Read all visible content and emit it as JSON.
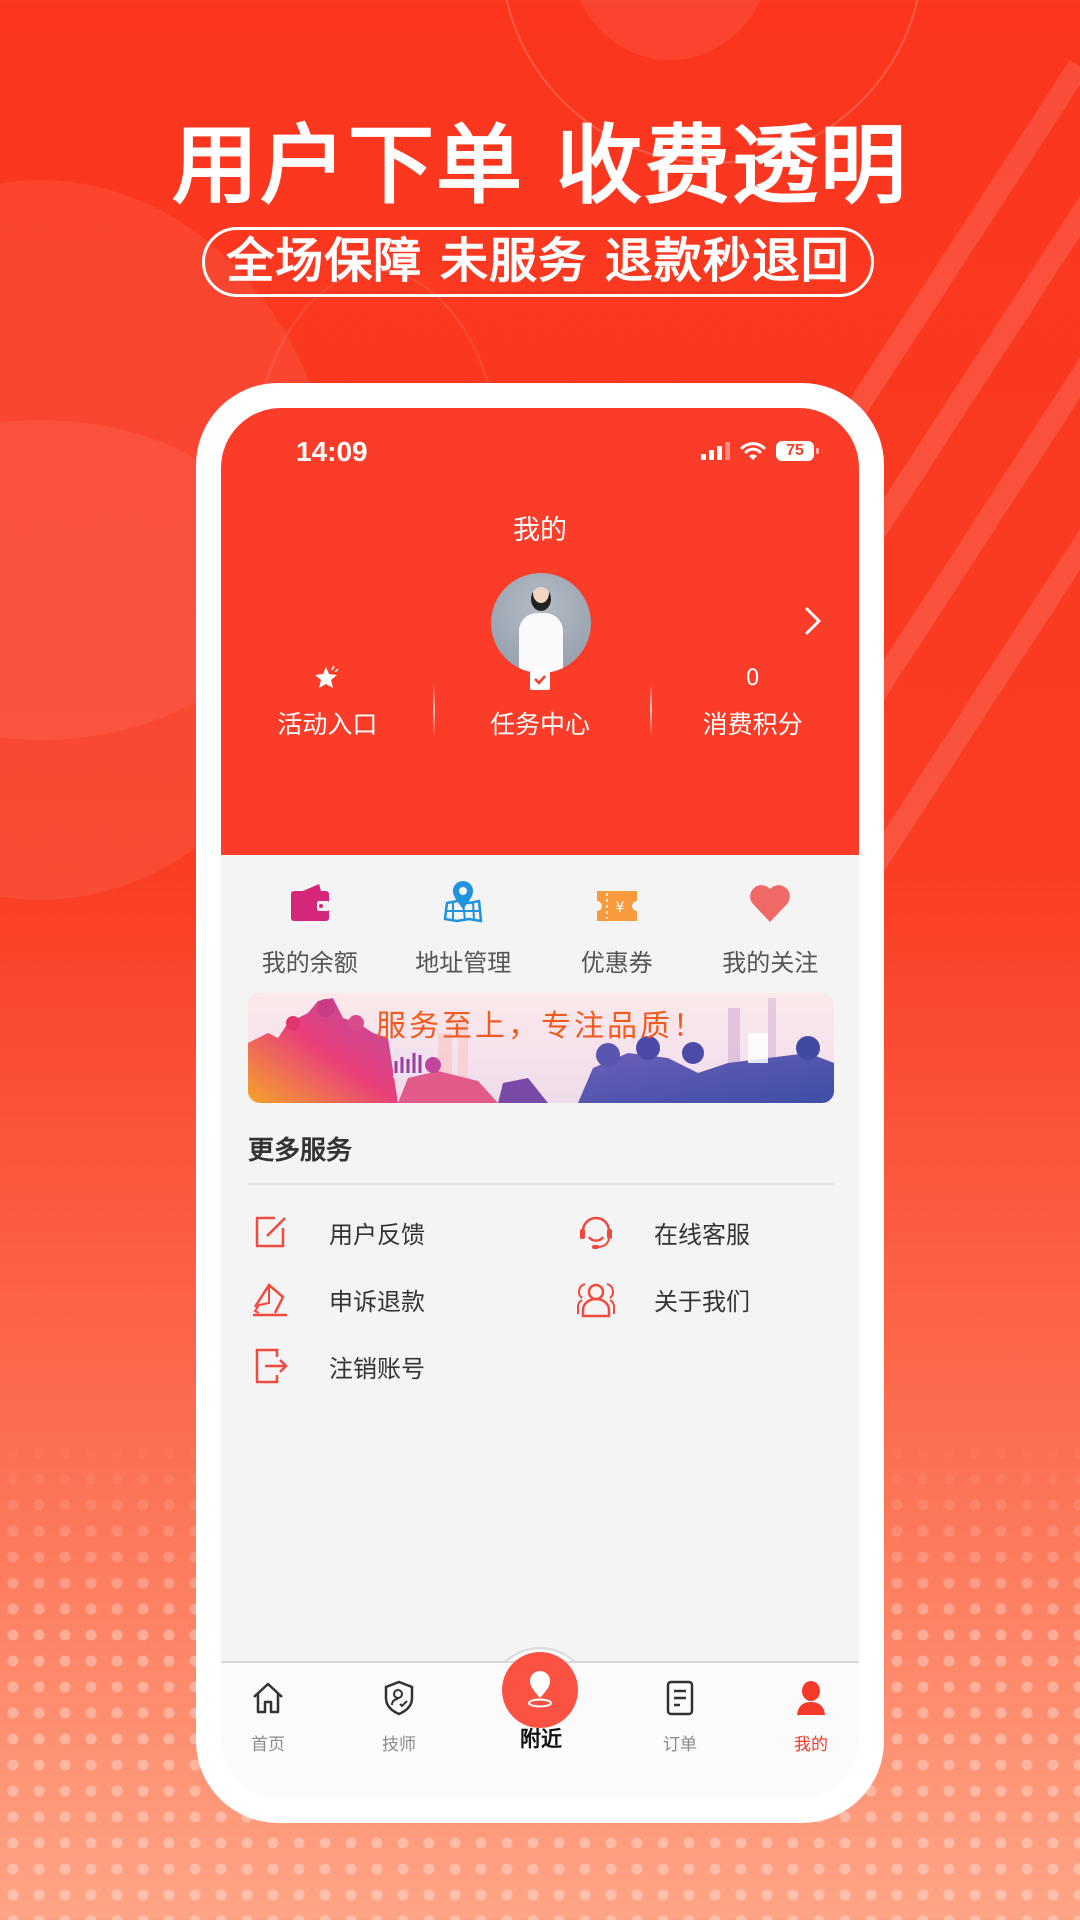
{
  "promo": {
    "headline": "用户下单 收费透明",
    "subline": "全场保障 未服务 退款秒退回"
  },
  "status_bar": {
    "time": "14:09",
    "battery": "75",
    "icons": [
      "signal-icon",
      "wifi-icon",
      "battery-icon"
    ]
  },
  "header": {
    "title": "我的",
    "avatar": "avatar",
    "profile_chevron": "chevron-right-icon"
  },
  "stats": [
    {
      "icon": "star-icon",
      "value": null,
      "label": "活动入口"
    },
    {
      "icon": "clipboard-check-icon",
      "value": null,
      "label": "任务中心"
    },
    {
      "icon": null,
      "value": "0",
      "label": "消费积分"
    }
  ],
  "quick_grid": [
    {
      "icon": "wallet-icon",
      "label": "我的余额",
      "color": "#d6267a"
    },
    {
      "icon": "map-pin-icon",
      "label": "地址管理",
      "color": "#1f93dc"
    },
    {
      "icon": "coupon-icon",
      "label": "优惠券",
      "color": "#f99a3c"
    },
    {
      "icon": "heart-icon",
      "label": "我的关注",
      "color": "#ef6a66"
    }
  ],
  "banner": {
    "text": "服务至上，专注品质！"
  },
  "more_services": {
    "title": "更多服务",
    "items": [
      {
        "icon": "edit-icon",
        "label": "用户反馈"
      },
      {
        "icon": "headset-icon",
        "label": "在线客服"
      },
      {
        "icon": "appeal-icon",
        "label": "申诉退款"
      },
      {
        "icon": "group-icon",
        "label": "关于我们"
      },
      {
        "icon": "logout-icon",
        "label": "注销账号"
      }
    ]
  },
  "tabbar": {
    "items": [
      {
        "icon": "home-icon",
        "label": "首页",
        "active": false
      },
      {
        "icon": "shield-user-icon",
        "label": "技师",
        "active": false
      },
      {
        "icon": "location-icon",
        "label": "附近",
        "active": false
      },
      {
        "icon": "order-icon",
        "label": "订单",
        "active": false
      },
      {
        "icon": "user-icon",
        "label": "我的",
        "active": true
      }
    ]
  },
  "colors": {
    "brand_red": "#fa3c28",
    "tab_active": "#f5392a",
    "service_icon": "#f04a3e"
  }
}
